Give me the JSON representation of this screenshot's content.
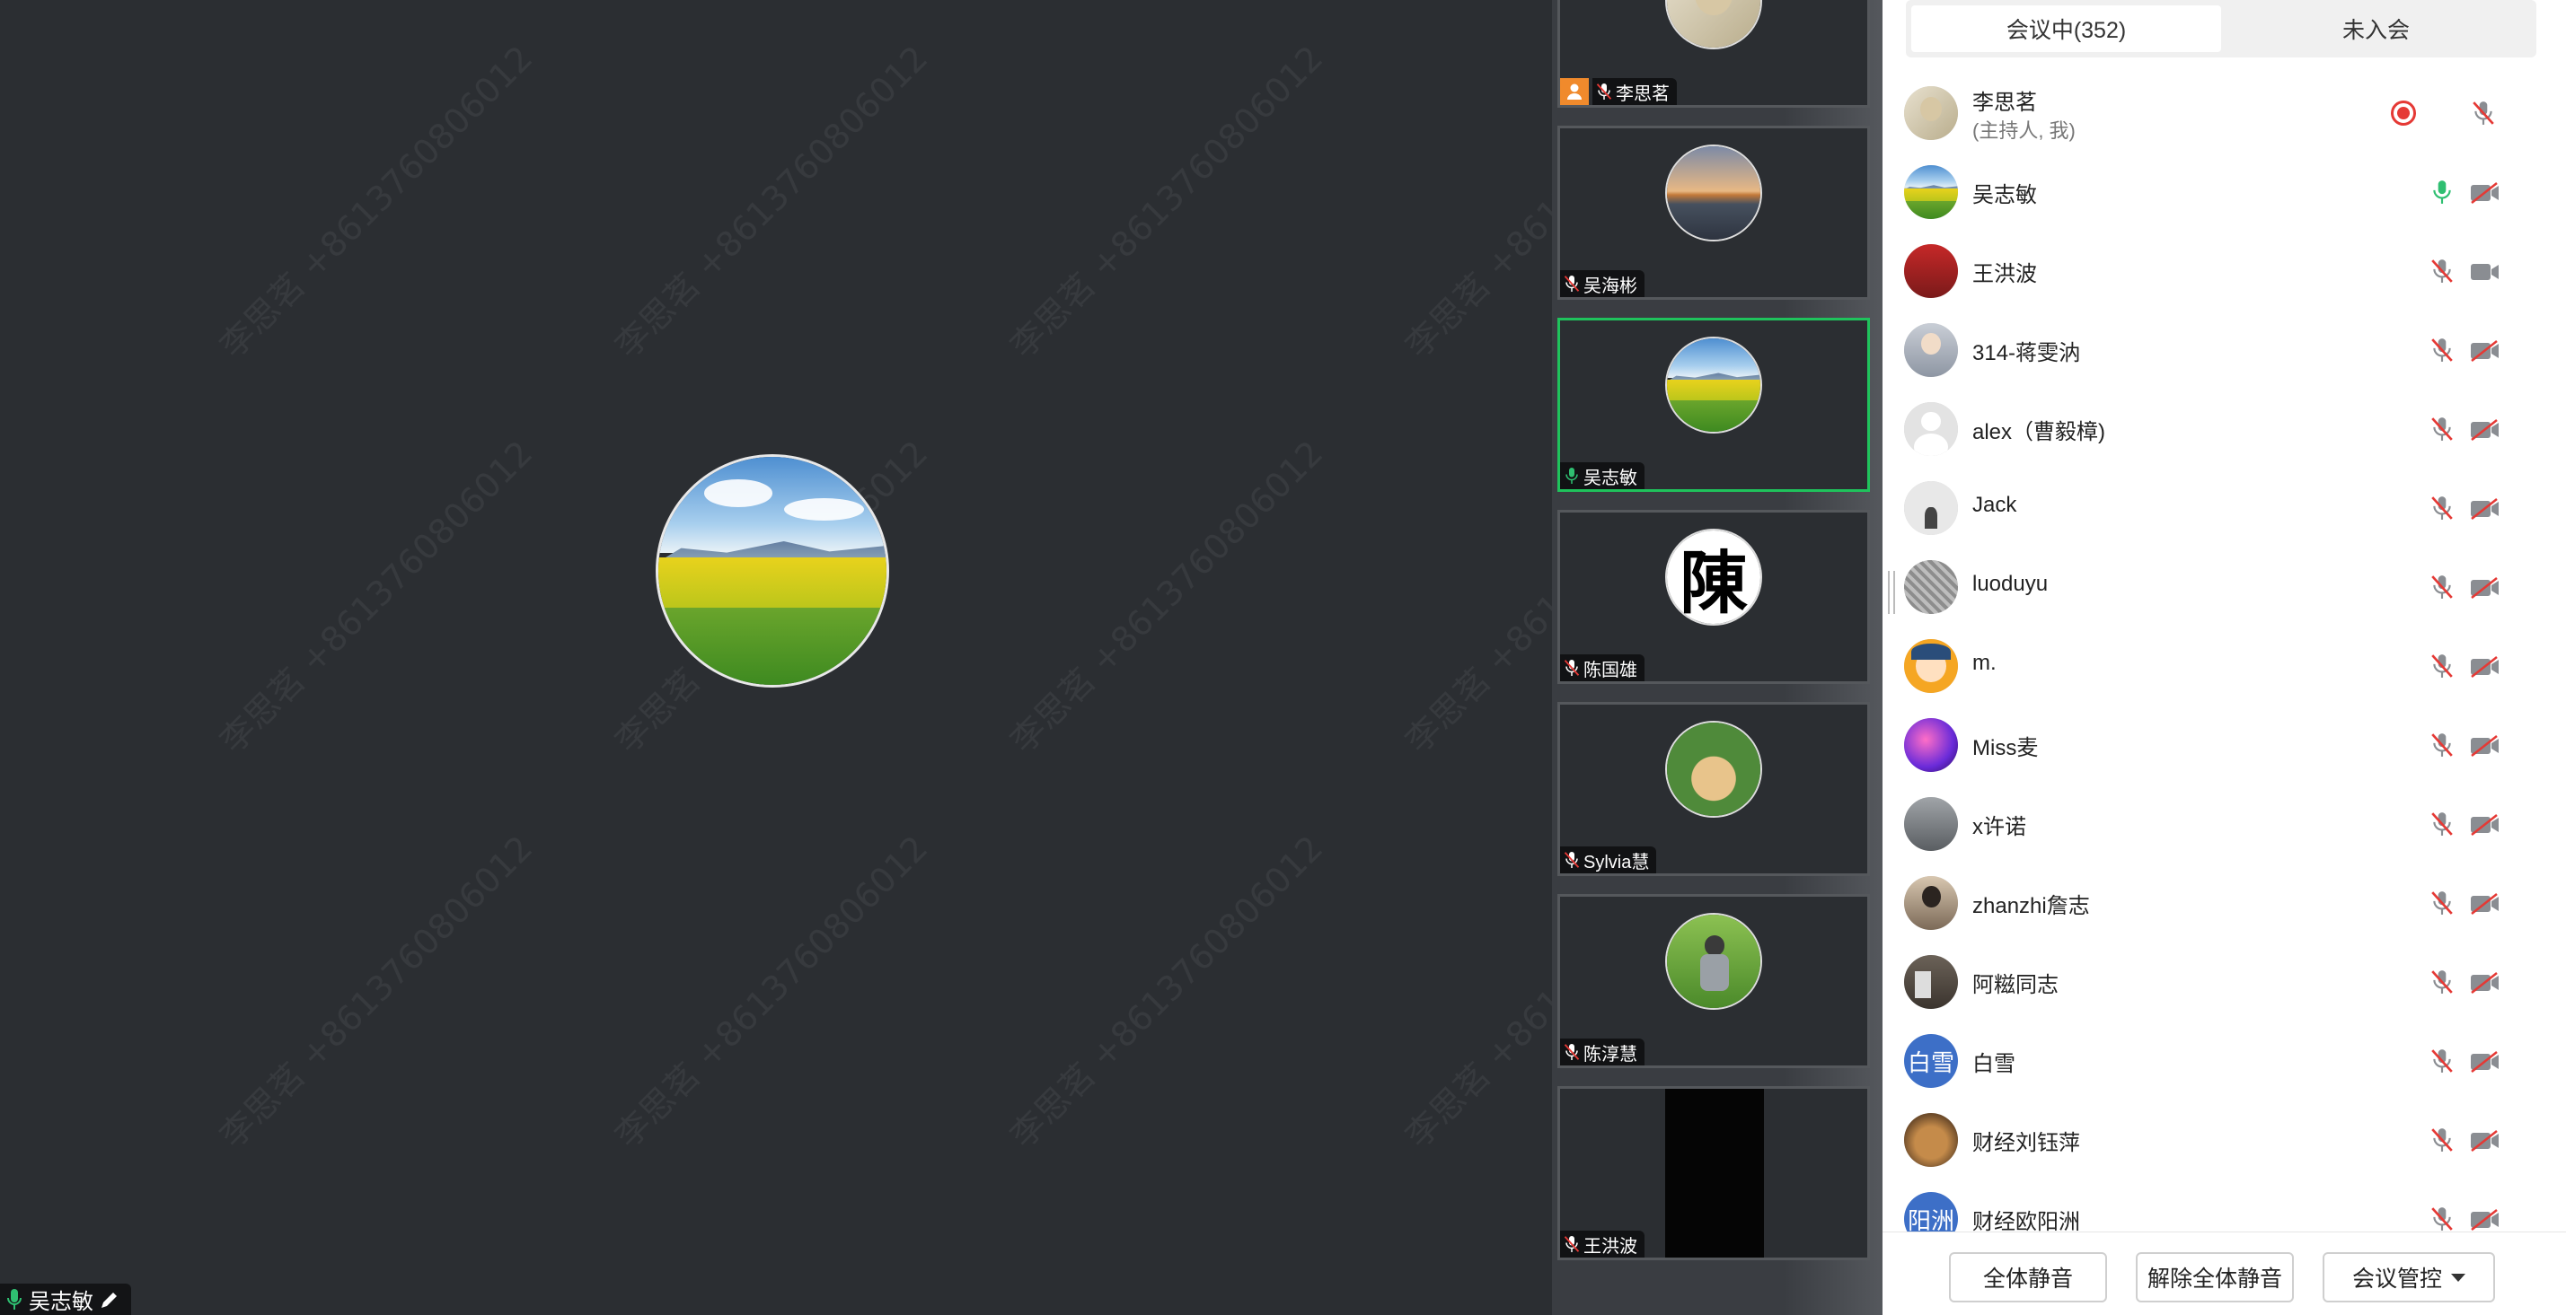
{
  "watermark_text": "李思茗 +8613760806012",
  "main": {
    "speaker_name": "吴志敏"
  },
  "thumbnails": [
    {
      "name": "李思茗",
      "host": true,
      "avatar": "portrait"
    },
    {
      "name": "吴海彬",
      "avatar": "sunset"
    },
    {
      "name": "吴志敏",
      "active": true,
      "avatar": "scenery"
    },
    {
      "name": "陈国雄",
      "avatar": "char",
      "char": "陳"
    },
    {
      "name": "Sylvia慧",
      "avatar": "cartoon"
    },
    {
      "name": "陈淳慧",
      "avatar": "child"
    },
    {
      "name": "王洪波",
      "avatar": "video"
    }
  ],
  "panel": {
    "tabs": [
      {
        "label": "会议中(352)",
        "selected": true
      },
      {
        "label": "未入会",
        "selected": false
      }
    ],
    "participants": [
      {
        "name": "李思茗",
        "sub": "(主持人, 我)",
        "mic": "muted",
        "cam": "off",
        "recording": true,
        "avatar": "portrait"
      },
      {
        "name": "吴志敏",
        "mic": "on",
        "cam": "off",
        "avatar": "scenery"
      },
      {
        "name": "王洪波",
        "mic": "muted",
        "cam": "on",
        "avatar": "red"
      },
      {
        "name": "314-蒋雯汭",
        "mic": "muted",
        "cam": "off",
        "avatar": "person"
      },
      {
        "name": "alex（曹毅樟)",
        "mic": "muted",
        "cam": "off",
        "avatar": "default"
      },
      {
        "name": "Jack",
        "mic": "muted",
        "cam": "off",
        "avatar": "grey"
      },
      {
        "name": "luoduyu",
        "mic": "muted",
        "cam": "off",
        "avatar": "sketch"
      },
      {
        "name": "m.",
        "mic": "muted",
        "cam": "off",
        "avatar": "girl"
      },
      {
        "name": "Miss麦",
        "mic": "muted",
        "cam": "off",
        "avatar": "purple"
      },
      {
        "name": "x许诺",
        "mic": "muted",
        "cam": "off",
        "avatar": "street"
      },
      {
        "name": "zhanzhi詹志",
        "mic": "muted",
        "cam": "off",
        "avatar": "woman"
      },
      {
        "name": "阿糍同志",
        "mic": "muted",
        "cam": "off",
        "avatar": "room"
      },
      {
        "name": "白雪",
        "mic": "muted",
        "cam": "off",
        "avatar": "text",
        "avatar_text": "白雪"
      },
      {
        "name": "财经刘钰萍",
        "mic": "muted",
        "cam": "off",
        "avatar": "dog"
      },
      {
        "name": "财经欧阳洲",
        "mic": "muted",
        "cam": "off",
        "avatar": "text",
        "avatar_text": "阳洲"
      }
    ],
    "footer": {
      "mute_all": "全体静音",
      "unmute_all": "解除全体静音",
      "manage": "会议管控"
    }
  },
  "colors": {
    "accent_green": "#1fc35c",
    "mic_on": "#2fbf71",
    "muted_red": "#e53935",
    "host_badge": "#f08a2c"
  }
}
